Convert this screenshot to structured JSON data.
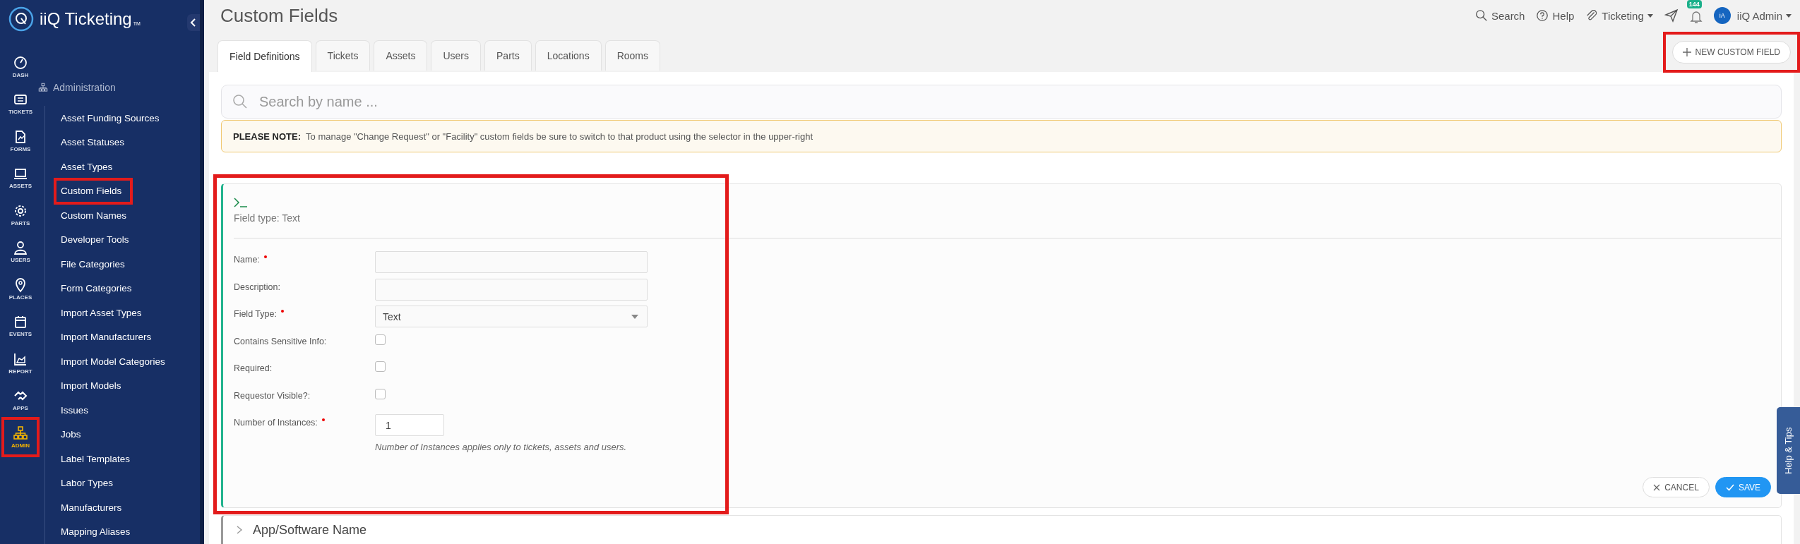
{
  "app": {
    "name": "iiQ Ticketing",
    "trademark": "TM"
  },
  "rail": [
    {
      "label": "DASH",
      "selected": false,
      "highlighted": false
    },
    {
      "label": "TICKETS",
      "selected": false,
      "highlighted": false
    },
    {
      "label": "FORMS",
      "selected": false,
      "highlighted": false
    },
    {
      "label": "ASSETS",
      "selected": false,
      "highlighted": false
    },
    {
      "label": "PARTS",
      "selected": false,
      "highlighted": false
    },
    {
      "label": "USERS",
      "selected": false,
      "highlighted": false
    },
    {
      "label": "PLACES",
      "selected": false,
      "highlighted": false
    },
    {
      "label": "EVENTS",
      "selected": false,
      "highlighted": false
    },
    {
      "label": "REPORT",
      "selected": false,
      "highlighted": false
    },
    {
      "label": "APPS",
      "selected": false,
      "highlighted": false
    },
    {
      "label": "ADMIN",
      "selected": true,
      "highlighted": true
    }
  ],
  "section": {
    "label": "Administration"
  },
  "menu": [
    {
      "label": "Asset Funding Sources",
      "highlighted": false
    },
    {
      "label": "Asset Statuses",
      "highlighted": false
    },
    {
      "label": "Asset Types",
      "highlighted": false
    },
    {
      "label": "Custom Fields",
      "highlighted": true
    },
    {
      "label": "Custom Names",
      "highlighted": false
    },
    {
      "label": "Developer Tools",
      "highlighted": false
    },
    {
      "label": "File Categories",
      "highlighted": false
    },
    {
      "label": "Form Categories",
      "highlighted": false
    },
    {
      "label": "Import Asset Types",
      "highlighted": false
    },
    {
      "label": "Import Manufacturers",
      "highlighted": false
    },
    {
      "label": "Import Model Categories",
      "highlighted": false
    },
    {
      "label": "Import Models",
      "highlighted": false
    },
    {
      "label": "Issues",
      "highlighted": false
    },
    {
      "label": "Jobs",
      "highlighted": false
    },
    {
      "label": "Label Templates",
      "highlighted": false
    },
    {
      "label": "Labor Types",
      "highlighted": false
    },
    {
      "label": "Manufacturers",
      "highlighted": false
    },
    {
      "label": "Mapping Aliases",
      "highlighted": false
    }
  ],
  "header": {
    "title": "Custom Fields",
    "search": "Search",
    "help": "Help",
    "product": "Ticketing",
    "badge": "144",
    "avatar": "iA",
    "user": "iiQ Admin"
  },
  "new_button": {
    "label": "NEW CUSTOM FIELD",
    "highlighted": true
  },
  "tabs": [
    {
      "label": "Field Definitions",
      "selected": true
    },
    {
      "label": "Tickets",
      "selected": false
    },
    {
      "label": "Assets",
      "selected": false
    },
    {
      "label": "Users",
      "selected": false
    },
    {
      "label": "Parts",
      "selected": false
    },
    {
      "label": "Locations",
      "selected": false
    },
    {
      "label": "Rooms",
      "selected": false
    }
  ],
  "search": {
    "placeholder": "Search by name ..."
  },
  "note": {
    "text": "**PLEASE NOTE:**  To manage \"Change Request\" or \"Facility\" custom fields be sure to switch to that product using the selector in the upper-right"
  },
  "card": {
    "highlighted": true,
    "type_label": "Field type: Text",
    "fields": [
      {
        "kind": "text",
        "label": "Name:",
        "required": true
      },
      {
        "kind": "text",
        "label": "Description:",
        "required": false
      },
      {
        "kind": "select",
        "label": "Field Type:",
        "required": true,
        "value": "Text"
      },
      {
        "kind": "checkbox",
        "label": "Contains Sensitive Info:",
        "required": false,
        "checked": false
      },
      {
        "kind": "checkbox",
        "label": "Required:",
        "required": false,
        "checked": false
      },
      {
        "kind": "checkbox",
        "label": "Requestor Visible?:",
        "required": false,
        "checked": false
      },
      {
        "kind": "number",
        "label": "Number of Instances:",
        "required": true,
        "value": "1",
        "hint": "Number of Instances applies only to tickets, assets and users."
      }
    ],
    "buttons": [
      {
        "kind": "cancel",
        "label": "CANCEL"
      },
      {
        "kind": "save",
        "label": "SAVE"
      }
    ]
  },
  "next_card": {
    "title": "App/Software Name"
  },
  "help_tab": {
    "label": "Help & Tips"
  }
}
